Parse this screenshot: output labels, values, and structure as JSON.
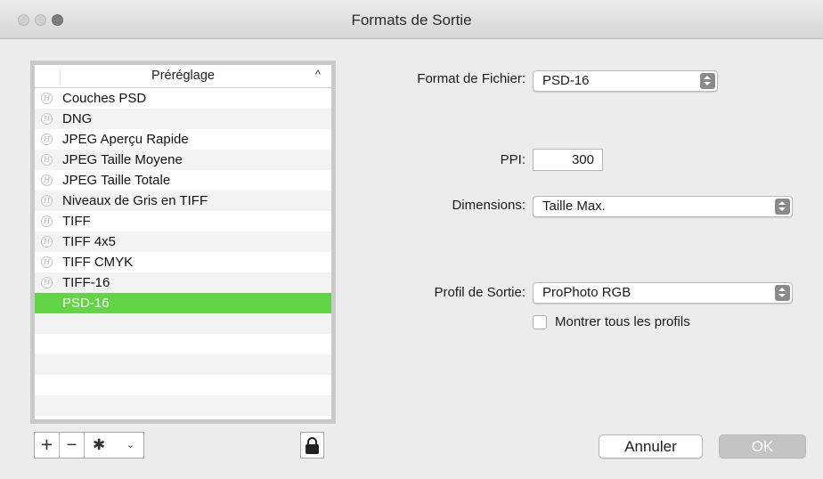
{
  "window": {
    "title": "Formats de Sortie"
  },
  "preset_list": {
    "header": "Préréglage",
    "sort_indicator": "^",
    "badge_glyph": "H",
    "items": [
      {
        "label": "Couches PSD",
        "has_badge": true
      },
      {
        "label": "DNG",
        "has_badge": true
      },
      {
        "label": "JPEG Aperçu Rapide",
        "has_badge": true
      },
      {
        "label": "JPEG Taille Moyene",
        "has_badge": true
      },
      {
        "label": "JPEG Taille Totale",
        "has_badge": true
      },
      {
        "label": "Niveaux de Gris en TIFF",
        "has_badge": true
      },
      {
        "label": "TIFF",
        "has_badge": true
      },
      {
        "label": "TIFF 4x5",
        "has_badge": true
      },
      {
        "label": "TIFF CMYK",
        "has_badge": true
      },
      {
        "label": "TIFF-16",
        "has_badge": true
      },
      {
        "label": "PSD-16",
        "has_badge": false,
        "selected": true
      }
    ],
    "selection_color": "#62d547"
  },
  "toolbar": {
    "add_symbol": "+",
    "remove_symbol": "−",
    "gear_symbol": "✱",
    "chevron_symbol": "⌄"
  },
  "form": {
    "file_format": {
      "label": "Format de Fichier:",
      "value": "PSD-16"
    },
    "ppi": {
      "label": "PPI:",
      "value": "300"
    },
    "dimensions": {
      "label": "Dimensions:",
      "value": "Taille Max."
    },
    "output_profile": {
      "label": "Profil de Sortie:",
      "value": "ProPhoto RGB"
    },
    "show_all_profiles": {
      "label": "Montrer tous les profils",
      "checked": false
    }
  },
  "buttons": {
    "cancel": "Annuler",
    "ok": "OK"
  }
}
